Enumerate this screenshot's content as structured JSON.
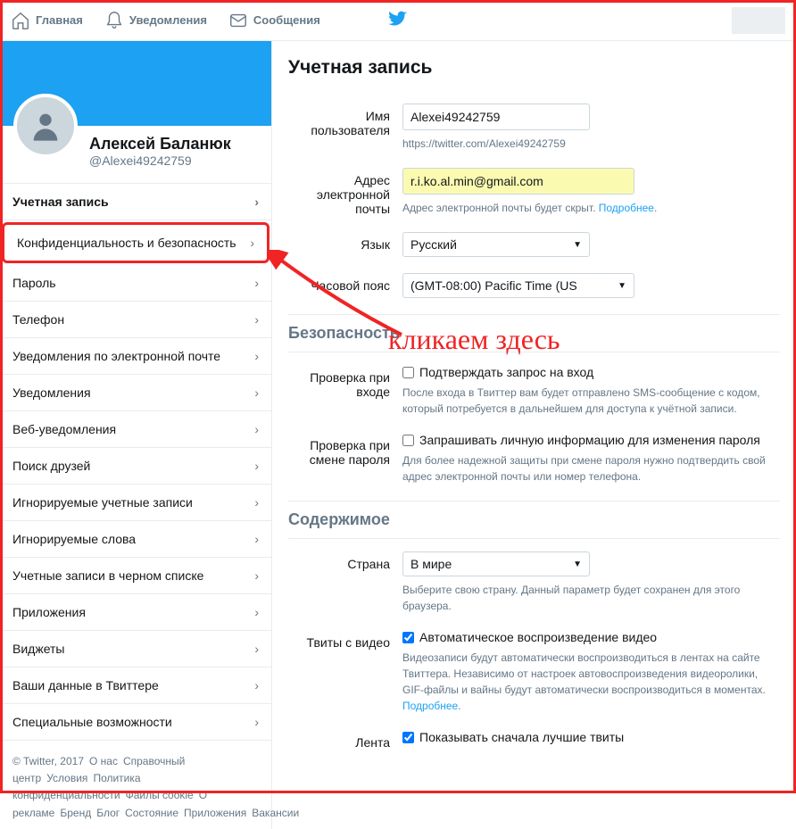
{
  "topnav": {
    "home": "Главная",
    "notifications": "Уведомления",
    "messages": "Сообщения"
  },
  "profile": {
    "name": "Алексей Баланюк",
    "handle": "@Alexei49242759"
  },
  "sidebar": {
    "items": [
      {
        "label": "Учетная запись",
        "bold": true
      },
      {
        "label": "Конфиденциальность и безопасность",
        "highlighted": true
      },
      {
        "label": "Пароль"
      },
      {
        "label": "Телефон"
      },
      {
        "label": "Уведомления по электронной почте"
      },
      {
        "label": "Уведомления"
      },
      {
        "label": "Веб-уведомления"
      },
      {
        "label": "Поиск друзей"
      },
      {
        "label": "Игнорируемые учетные записи"
      },
      {
        "label": "Игнорируемые слова"
      },
      {
        "label": "Учетные записи в черном списке"
      },
      {
        "label": "Приложения"
      },
      {
        "label": "Виджеты"
      },
      {
        "label": "Ваши данные в Твиттере"
      },
      {
        "label": "Специальные возможности"
      }
    ]
  },
  "footer": {
    "copyright": "© Twitter, 2017",
    "links": [
      "О нас",
      "Справочный центр",
      "Условия",
      "Политика конфиденциальности",
      "Файлы cookie",
      "О рекламе",
      "Бренд",
      "Блог",
      "Состояние",
      "Приложения",
      "Вакансии"
    ]
  },
  "main": {
    "title": "Учетная запись",
    "username_label": "Имя пользователя",
    "username_value": "Alexei49242759",
    "username_url": "https://twitter.com/Alexei49242759",
    "email_label": "Адрес электронной почты",
    "email_value": "r.i.ko.al.min@gmail.com",
    "email_help_pre": "Адрес электронной почты будет скрыт.",
    "email_help_link": "Подробнее",
    "language_label": "Язык",
    "language_value": "Русский",
    "timezone_label": "Часовой пояс",
    "timezone_value": "(GMT-08:00) Pacific Time (US",
    "section_security": "Безопасность",
    "login_verify_label": "Проверка при входе",
    "login_verify_check": "Подтверждать запрос на вход",
    "login_verify_help": "После входа в Твиттер вам будет отправлено SMS-сообщение с кодом, который потребуется в дальнейшем для доступа к учётной записи.",
    "pw_verify_label": "Проверка при смене пароля",
    "pw_verify_check": "Запрашивать личную информацию для изменения пароля",
    "pw_verify_help": "Для более надежной защиты при смене пароля нужно подтвердить свой адрес электронной почты или номер телефона.",
    "section_content": "Содержимое",
    "country_label": "Страна",
    "country_value": "В мире",
    "country_help": "Выберите свою страну. Данный параметр будет сохранен для этого браузера.",
    "video_label": "Твиты с видео",
    "video_check": "Автоматическое воспроизведение видео",
    "video_check_checked": true,
    "video_help_pre": "Видеозаписи будут автоматически воспроизводиться в лентах на сайте Твиттера. Независимо от настроек автовоспроизведения видеоролики, GIF-файлы и вайны будут автоматически воспроизводиться в моментах.",
    "video_help_link": "Подробнее",
    "feed_label": "Лента",
    "feed_check": "Показывать сначала лучшие твиты",
    "feed_check_checked": true
  },
  "annotation": "кликаем здесь"
}
